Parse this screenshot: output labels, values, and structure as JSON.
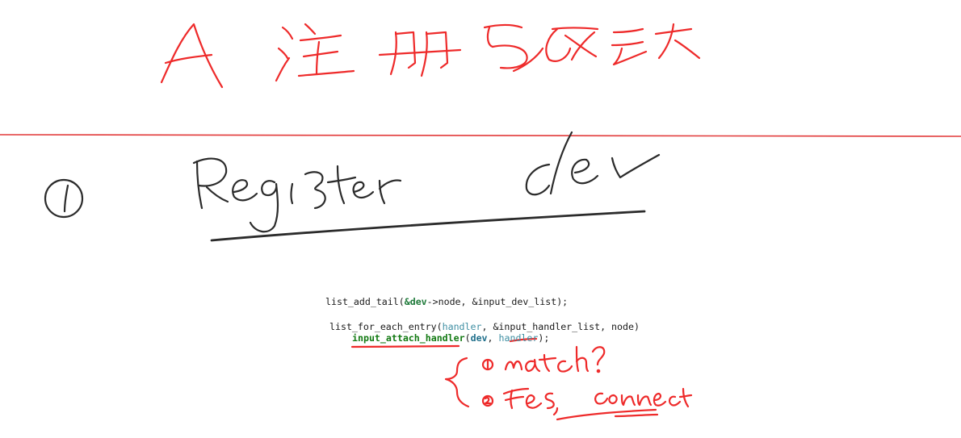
{
  "code": {
    "line1": {
      "pre": "list_add_tail(",
      "arg1": "&dev",
      "arg1_rest": "->node, &input_dev_list);"
    },
    "line2": {
      "pre": "list_for_each_entry(",
      "handler": "handler",
      "rest": ", &input_handler_list, node)"
    },
    "line3": {
      "fn": "input_attach_handler",
      "open": "(",
      "dev": "dev",
      "sep": ", ",
      "handler": "handler",
      "close": ");"
    }
  },
  "colors": {
    "ink_red": "#ee2a2a",
    "ink_black": "#2b2b2b",
    "code_keyword": "#1f7a3a",
    "code_identifier": "#3f8fa3"
  }
}
